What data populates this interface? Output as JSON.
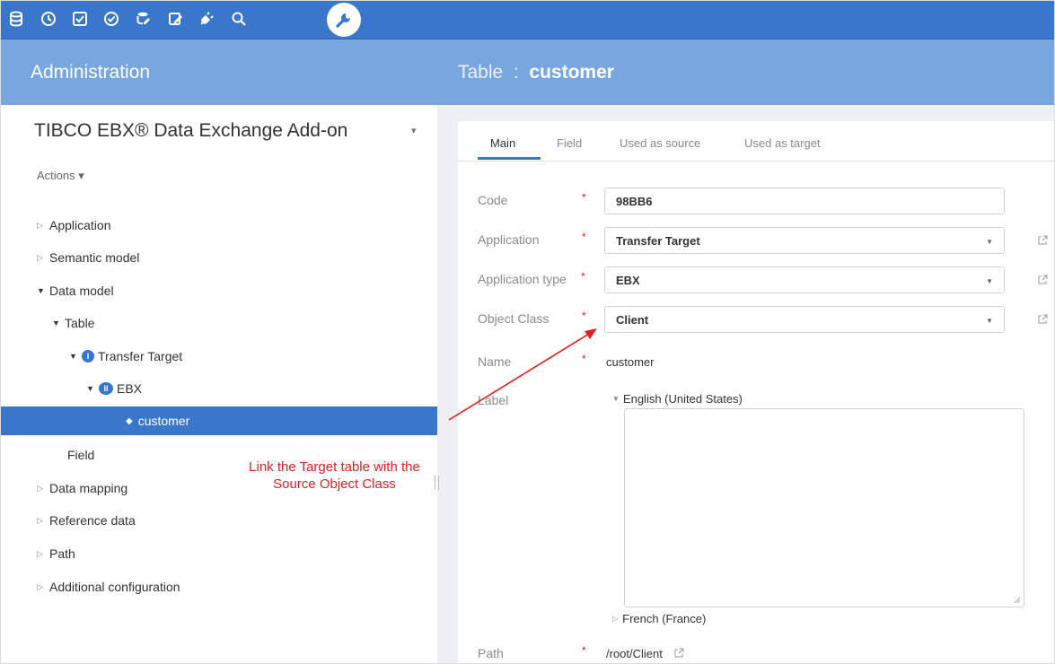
{
  "toolbar": {
    "icons": [
      "database-icon",
      "clock-icon",
      "checkbox-icon",
      "check-circle-icon",
      "database-edit-icon",
      "task-edit-icon",
      "plug-icon",
      "search-icon",
      "wrench-icon"
    ],
    "active_icon": "wrench-icon"
  },
  "header": {
    "admin_title": "Administration",
    "page_title_prefix": "Table  :  ",
    "page_title_value": "customer"
  },
  "left": {
    "dataspace_title": "TIBCO EBX® Data Exchange Add-on",
    "actions_label": "Actions",
    "tree": [
      {
        "label": "Application"
      },
      {
        "label": "Semantic model"
      },
      {
        "label": "Data model"
      },
      {
        "label": "Table"
      },
      {
        "label": "Transfer Target",
        "badge": "I"
      },
      {
        "label": "EBX",
        "badge": "II"
      },
      {
        "label": "customer",
        "selected": true
      },
      {
        "label": "Field"
      },
      {
        "label": "Data mapping"
      },
      {
        "label": "Reference data"
      },
      {
        "label": "Path"
      },
      {
        "label": "Additional configuration"
      }
    ],
    "annotation": "Link the Target table with the Source Object Class"
  },
  "tabs": [
    "Main",
    "Field",
    "Used as source",
    "Used as target"
  ],
  "form": {
    "code_label": "Code",
    "code_value": "98BB6",
    "application_label": "Application",
    "application_value": "Transfer Target",
    "application_type_label": "Application type",
    "application_type_value": "EBX",
    "object_class_label": "Object Class",
    "object_class_value": "Client",
    "name_label": "Name",
    "name_value": "customer",
    "label_label": "Label",
    "lang_en": "English (United States)",
    "lang_fr": "French (France)",
    "path_label": "Path",
    "path_value": "/root/Client",
    "required_mark": "*"
  },
  "colors": {
    "toolbar": "#3a76c9",
    "header": "#78a6df",
    "selection": "#3a76c9",
    "annotation": "#e02020"
  }
}
